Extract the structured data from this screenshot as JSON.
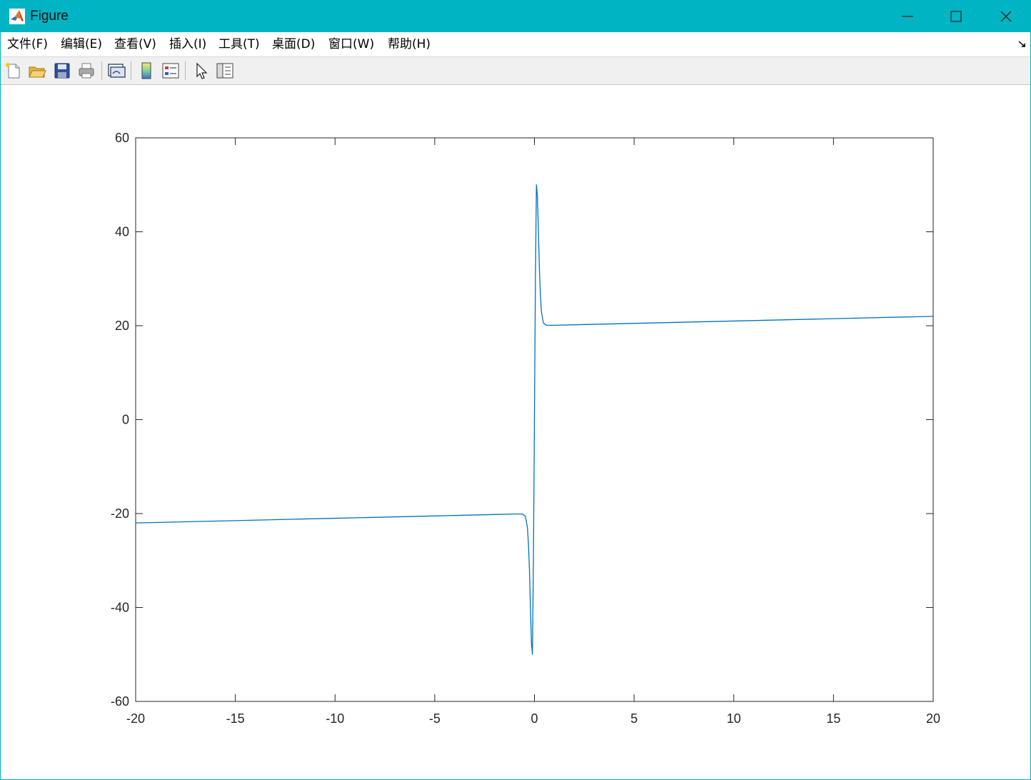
{
  "window": {
    "title": "Figure",
    "controls": [
      "minimize",
      "maximize",
      "close"
    ]
  },
  "menubar": {
    "items": [
      {
        "label": "文件(F)"
      },
      {
        "label": "编辑(E)"
      },
      {
        "label": "查看(V)"
      },
      {
        "label": "插入(I)"
      },
      {
        "label": "工具(T)"
      },
      {
        "label": "桌面(D)"
      },
      {
        "label": "窗口(W)"
      },
      {
        "label": "帮助(H)"
      }
    ]
  },
  "toolbar": {
    "buttons": [
      "new-figure-icon",
      "open-file-icon",
      "save-icon",
      "print-icon",
      "link-plot-icon",
      "colorbar-icon",
      "legend-icon",
      "edit-plot-pointer-icon",
      "property-inspector-icon"
    ]
  },
  "colors": {
    "titlebar": "#00b4c3",
    "line": "#0072bd",
    "axis": "#262626"
  },
  "chart_data": {
    "type": "line",
    "title": "",
    "xlabel": "",
    "ylabel": "",
    "xlim": [
      -20,
      20
    ],
    "ylim": [
      -60,
      60
    ],
    "xticks": [
      -20,
      -15,
      -10,
      -5,
      0,
      5,
      10,
      15,
      20
    ],
    "yticks": [
      -60,
      -40,
      -20,
      0,
      20,
      40,
      60
    ],
    "xtick_labels": [
      "-20",
      "-15",
      "-10",
      "-5",
      "0",
      "5",
      "10",
      "15",
      "20"
    ],
    "ytick_labels": [
      "-60",
      "-40",
      "-20",
      "0",
      "20",
      "40",
      "60"
    ],
    "grid": false,
    "box": true,
    "series": [
      {
        "color": "#0072bd",
        "x": [
          -20,
          -15,
          -10,
          -5,
          -2,
          -1,
          -0.6,
          -0.45,
          -0.35,
          -0.3,
          -0.25,
          -0.2,
          -0.15,
          -0.1,
          -0.05,
          0,
          0.05,
          0.1,
          0.15,
          0.2,
          0.25,
          0.3,
          0.35,
          0.45,
          0.6,
          1,
          2,
          5,
          10,
          15,
          20
        ],
        "y": [
          -22.0,
          -21.5,
          -21.0,
          -20.5,
          -20.2,
          -20.1,
          -20.1,
          -20.6,
          -23.0,
          -26.5,
          -32.0,
          -40.0,
          -47.5,
          -50.0,
          -30.0,
          0.0,
          30.0,
          50.0,
          47.5,
          40.0,
          32.0,
          26.5,
          23.0,
          20.6,
          20.1,
          20.1,
          20.2,
          20.5,
          21.0,
          21.5,
          22.0
        ]
      }
    ]
  }
}
